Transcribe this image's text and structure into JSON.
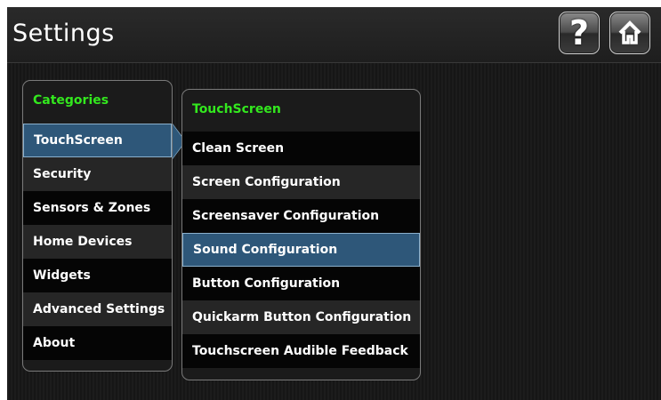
{
  "header": {
    "title": "Settings",
    "help_label": "?",
    "help_icon": "help-icon",
    "home_icon": "home-icon"
  },
  "categories": {
    "heading": "Categories",
    "selected": "TouchScreen",
    "items": [
      {
        "label": "TouchScreen"
      },
      {
        "label": "Security"
      },
      {
        "label": "Sensors & Zones"
      },
      {
        "label": "Home Devices"
      },
      {
        "label": "Widgets"
      },
      {
        "label": "Advanced Settings"
      },
      {
        "label": "About"
      }
    ]
  },
  "submenu": {
    "heading": "TouchScreen",
    "selected": "Sound Configuration",
    "items": [
      {
        "label": "Clean Screen"
      },
      {
        "label": "Screen Configuration"
      },
      {
        "label": "Screensaver Configuration"
      },
      {
        "label": "Sound Configuration"
      },
      {
        "label": "Button Configuration"
      },
      {
        "label": "Quickarm Button Configuration"
      },
      {
        "label": "Touchscreen Audible Feedback"
      }
    ]
  },
  "colors": {
    "heading_green": "#33e81e",
    "selection_blue": "#2e5779",
    "selection_border": "#8ab0cc"
  }
}
